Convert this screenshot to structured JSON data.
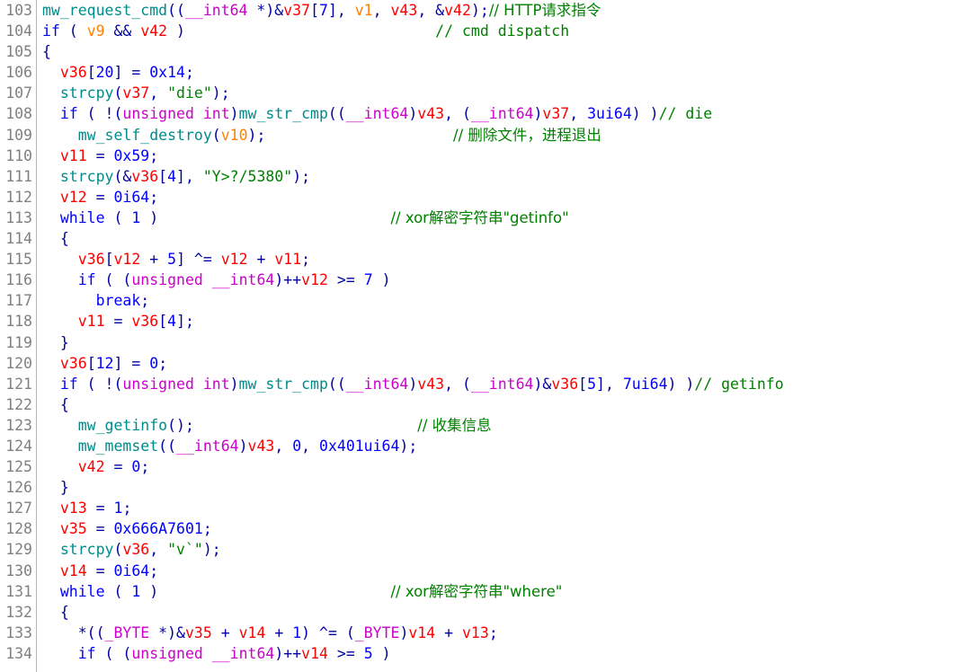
{
  "view": {
    "name": "ida-pseudocode-view",
    "background": "#ffffff",
    "gutter_color": "#808080",
    "separator_color": "#b4b4b4"
  },
  "colors": {
    "keyword": "#0000ff",
    "type": "#cc00cc",
    "function": "#008b8b",
    "local_var": "#ff0000",
    "argument": "#ff8000",
    "number": "#0000ff",
    "string": "#008000",
    "comment": "#008000",
    "punctuation": "#0000a0",
    "default": "#000000"
  },
  "lines": [
    {
      "number": "103",
      "tokens": [
        {
          "t": "mw_request_cmd",
          "c": "func"
        },
        {
          "t": "((",
          "c": "punct"
        },
        {
          "t": "__int64",
          "c": "type"
        },
        {
          "t": " *)&",
          "c": "punct"
        },
        {
          "t": "v37",
          "c": "lvar"
        },
        {
          "t": "[",
          "c": "punct"
        },
        {
          "t": "7",
          "c": "number"
        },
        {
          "t": "], ",
          "c": "punct"
        },
        {
          "t": "v1",
          "c": "arg"
        },
        {
          "t": ", ",
          "c": "punct"
        },
        {
          "t": "v43",
          "c": "lvar"
        },
        {
          "t": ", &",
          "c": "punct"
        },
        {
          "t": "v42",
          "c": "lvar"
        },
        {
          "t": ");",
          "c": "punct"
        },
        {
          "t": "// HTTP请求指令",
          "c": "comment"
        }
      ]
    },
    {
      "number": "104",
      "tokens": [
        {
          "t": "if",
          "c": "keyword"
        },
        {
          "t": " ( ",
          "c": "punct"
        },
        {
          "t": "v9",
          "c": "arg"
        },
        {
          "t": " && ",
          "c": "punct"
        },
        {
          "t": "v42",
          "c": "lvar"
        },
        {
          "t": " )",
          "c": "punct"
        },
        {
          "t": "                            ",
          "c": "default"
        },
        {
          "t": "// cmd dispatch",
          "c": "comment"
        }
      ]
    },
    {
      "number": "105",
      "tokens": [
        {
          "t": "{",
          "c": "punct"
        }
      ]
    },
    {
      "number": "106",
      "tokens": [
        {
          "t": "  ",
          "c": "default"
        },
        {
          "t": "v36",
          "c": "lvar"
        },
        {
          "t": "[",
          "c": "punct"
        },
        {
          "t": "20",
          "c": "number"
        },
        {
          "t": "] = ",
          "c": "punct"
        },
        {
          "t": "0x14",
          "c": "number"
        },
        {
          "t": ";",
          "c": "punct"
        }
      ]
    },
    {
      "number": "107",
      "tokens": [
        {
          "t": "  ",
          "c": "default"
        },
        {
          "t": "strcpy",
          "c": "func"
        },
        {
          "t": "(",
          "c": "punct"
        },
        {
          "t": "v37",
          "c": "lvar"
        },
        {
          "t": ", ",
          "c": "punct"
        },
        {
          "t": "\"die\"",
          "c": "string"
        },
        {
          "t": ");",
          "c": "punct"
        }
      ]
    },
    {
      "number": "108",
      "tokens": [
        {
          "t": "  ",
          "c": "default"
        },
        {
          "t": "if",
          "c": "keyword"
        },
        {
          "t": " ( !(",
          "c": "punct"
        },
        {
          "t": "unsigned int",
          "c": "type"
        },
        {
          "t": ")",
          "c": "punct"
        },
        {
          "t": "mw_str_cmp",
          "c": "func"
        },
        {
          "t": "((",
          "c": "punct"
        },
        {
          "t": "__int64",
          "c": "type"
        },
        {
          "t": ")",
          "c": "punct"
        },
        {
          "t": "v43",
          "c": "lvar"
        },
        {
          "t": ", (",
          "c": "punct"
        },
        {
          "t": "__int64",
          "c": "type"
        },
        {
          "t": ")",
          "c": "punct"
        },
        {
          "t": "v37",
          "c": "lvar"
        },
        {
          "t": ", ",
          "c": "punct"
        },
        {
          "t": "3ui64",
          "c": "number"
        },
        {
          "t": ") )",
          "c": "punct"
        },
        {
          "t": "// die",
          "c": "comment"
        }
      ]
    },
    {
      "number": "109",
      "tokens": [
        {
          "t": "    ",
          "c": "default"
        },
        {
          "t": "mw_self_destroy",
          "c": "func"
        },
        {
          "t": "(",
          "c": "punct"
        },
        {
          "t": "v10",
          "c": "arg"
        },
        {
          "t": ");",
          "c": "punct"
        },
        {
          "t": "                     ",
          "c": "default"
        },
        {
          "t": "// 删除文件，进程退出",
          "c": "comment"
        }
      ]
    },
    {
      "number": "110",
      "tokens": [
        {
          "t": "  ",
          "c": "default"
        },
        {
          "t": "v11",
          "c": "lvar"
        },
        {
          "t": " = ",
          "c": "punct"
        },
        {
          "t": "0x59",
          "c": "number"
        },
        {
          "t": ";",
          "c": "punct"
        }
      ]
    },
    {
      "number": "111",
      "tokens": [
        {
          "t": "  ",
          "c": "default"
        },
        {
          "t": "strcpy",
          "c": "func"
        },
        {
          "t": "(&",
          "c": "punct"
        },
        {
          "t": "v36",
          "c": "lvar"
        },
        {
          "t": "[",
          "c": "punct"
        },
        {
          "t": "4",
          "c": "number"
        },
        {
          "t": "], ",
          "c": "punct"
        },
        {
          "t": "\"Y>?/5380\"",
          "c": "string"
        },
        {
          "t": ");",
          "c": "punct"
        }
      ]
    },
    {
      "number": "112",
      "tokens": [
        {
          "t": "  ",
          "c": "default"
        },
        {
          "t": "v12",
          "c": "lvar"
        },
        {
          "t": " = ",
          "c": "punct"
        },
        {
          "t": "0i64",
          "c": "number"
        },
        {
          "t": ";",
          "c": "punct"
        }
      ]
    },
    {
      "number": "113",
      "tokens": [
        {
          "t": "  ",
          "c": "default"
        },
        {
          "t": "while",
          "c": "keyword"
        },
        {
          "t": " ( ",
          "c": "punct"
        },
        {
          "t": "1",
          "c": "number"
        },
        {
          "t": " )",
          "c": "punct"
        },
        {
          "t": "                          ",
          "c": "default"
        },
        {
          "t": "// xor解密字符串\"getinfo\"",
          "c": "comment"
        }
      ]
    },
    {
      "number": "114",
      "tokens": [
        {
          "t": "  {",
          "c": "punct"
        }
      ]
    },
    {
      "number": "115",
      "tokens": [
        {
          "t": "    ",
          "c": "default"
        },
        {
          "t": "v36",
          "c": "lvar"
        },
        {
          "t": "[",
          "c": "punct"
        },
        {
          "t": "v12",
          "c": "lvar"
        },
        {
          "t": " + ",
          "c": "punct"
        },
        {
          "t": "5",
          "c": "number"
        },
        {
          "t": "] ^= ",
          "c": "punct"
        },
        {
          "t": "v12",
          "c": "lvar"
        },
        {
          "t": " + ",
          "c": "punct"
        },
        {
          "t": "v11",
          "c": "lvar"
        },
        {
          "t": ";",
          "c": "punct"
        }
      ]
    },
    {
      "number": "116",
      "tokens": [
        {
          "t": "    ",
          "c": "default"
        },
        {
          "t": "if",
          "c": "keyword"
        },
        {
          "t": " ( (",
          "c": "punct"
        },
        {
          "t": "unsigned __int64",
          "c": "type"
        },
        {
          "t": ")++",
          "c": "punct"
        },
        {
          "t": "v12",
          "c": "lvar"
        },
        {
          "t": " >= ",
          "c": "punct"
        },
        {
          "t": "7",
          "c": "number"
        },
        {
          "t": " )",
          "c": "punct"
        }
      ]
    },
    {
      "number": "117",
      "tokens": [
        {
          "t": "      ",
          "c": "default"
        },
        {
          "t": "break",
          "c": "keyword"
        },
        {
          "t": ";",
          "c": "punct"
        }
      ]
    },
    {
      "number": "118",
      "tokens": [
        {
          "t": "    ",
          "c": "default"
        },
        {
          "t": "v11",
          "c": "lvar"
        },
        {
          "t": " = ",
          "c": "punct"
        },
        {
          "t": "v36",
          "c": "lvar"
        },
        {
          "t": "[",
          "c": "punct"
        },
        {
          "t": "4",
          "c": "number"
        },
        {
          "t": "];",
          "c": "punct"
        }
      ]
    },
    {
      "number": "119",
      "tokens": [
        {
          "t": "  }",
          "c": "punct"
        }
      ]
    },
    {
      "number": "120",
      "tokens": [
        {
          "t": "  ",
          "c": "default"
        },
        {
          "t": "v36",
          "c": "lvar"
        },
        {
          "t": "[",
          "c": "punct"
        },
        {
          "t": "12",
          "c": "number"
        },
        {
          "t": "] = ",
          "c": "punct"
        },
        {
          "t": "0",
          "c": "number"
        },
        {
          "t": ";",
          "c": "punct"
        }
      ]
    },
    {
      "number": "121",
      "tokens": [
        {
          "t": "  ",
          "c": "default"
        },
        {
          "t": "if",
          "c": "keyword"
        },
        {
          "t": " ( !(",
          "c": "punct"
        },
        {
          "t": "unsigned int",
          "c": "type"
        },
        {
          "t": ")",
          "c": "punct"
        },
        {
          "t": "mw_str_cmp",
          "c": "func"
        },
        {
          "t": "((",
          "c": "punct"
        },
        {
          "t": "__int64",
          "c": "type"
        },
        {
          "t": ")",
          "c": "punct"
        },
        {
          "t": "v43",
          "c": "lvar"
        },
        {
          "t": ", (",
          "c": "punct"
        },
        {
          "t": "__int64",
          "c": "type"
        },
        {
          "t": ")&",
          "c": "punct"
        },
        {
          "t": "v36",
          "c": "lvar"
        },
        {
          "t": "[",
          "c": "punct"
        },
        {
          "t": "5",
          "c": "number"
        },
        {
          "t": "], ",
          "c": "punct"
        },
        {
          "t": "7ui64",
          "c": "number"
        },
        {
          "t": ") )",
          "c": "punct"
        },
        {
          "t": "// getinfo",
          "c": "comment"
        }
      ]
    },
    {
      "number": "122",
      "tokens": [
        {
          "t": "  {",
          "c": "punct"
        }
      ]
    },
    {
      "number": "123",
      "tokens": [
        {
          "t": "    ",
          "c": "default"
        },
        {
          "t": "mw_getinfo",
          "c": "func"
        },
        {
          "t": "();",
          "c": "punct"
        },
        {
          "t": "                         ",
          "c": "default"
        },
        {
          "t": "// 收集信息",
          "c": "comment"
        }
      ]
    },
    {
      "number": "124",
      "tokens": [
        {
          "t": "    ",
          "c": "default"
        },
        {
          "t": "mw_memset",
          "c": "func"
        },
        {
          "t": "((",
          "c": "punct"
        },
        {
          "t": "__int64",
          "c": "type"
        },
        {
          "t": ")",
          "c": "punct"
        },
        {
          "t": "v43",
          "c": "lvar"
        },
        {
          "t": ", ",
          "c": "punct"
        },
        {
          "t": "0",
          "c": "number"
        },
        {
          "t": ", ",
          "c": "punct"
        },
        {
          "t": "0x401ui64",
          "c": "number"
        },
        {
          "t": ");",
          "c": "punct"
        }
      ]
    },
    {
      "number": "125",
      "tokens": [
        {
          "t": "    ",
          "c": "default"
        },
        {
          "t": "v42",
          "c": "lvar"
        },
        {
          "t": " = ",
          "c": "punct"
        },
        {
          "t": "0",
          "c": "number"
        },
        {
          "t": ";",
          "c": "punct"
        }
      ]
    },
    {
      "number": "126",
      "tokens": [
        {
          "t": "  }",
          "c": "punct"
        }
      ]
    },
    {
      "number": "127",
      "tokens": [
        {
          "t": "  ",
          "c": "default"
        },
        {
          "t": "v13",
          "c": "lvar"
        },
        {
          "t": " = ",
          "c": "punct"
        },
        {
          "t": "1",
          "c": "number"
        },
        {
          "t": ";",
          "c": "punct"
        }
      ]
    },
    {
      "number": "128",
      "tokens": [
        {
          "t": "  ",
          "c": "default"
        },
        {
          "t": "v35",
          "c": "lvar"
        },
        {
          "t": " = ",
          "c": "punct"
        },
        {
          "t": "0x666A7601",
          "c": "number"
        },
        {
          "t": ";",
          "c": "punct"
        }
      ]
    },
    {
      "number": "129",
      "tokens": [
        {
          "t": "  ",
          "c": "default"
        },
        {
          "t": "strcpy",
          "c": "func"
        },
        {
          "t": "(",
          "c": "punct"
        },
        {
          "t": "v36",
          "c": "lvar"
        },
        {
          "t": ", ",
          "c": "punct"
        },
        {
          "t": "\"v`\"",
          "c": "string"
        },
        {
          "t": ");",
          "c": "punct"
        }
      ]
    },
    {
      "number": "130",
      "tokens": [
        {
          "t": "  ",
          "c": "default"
        },
        {
          "t": "v14",
          "c": "lvar"
        },
        {
          "t": " = ",
          "c": "punct"
        },
        {
          "t": "0i64",
          "c": "number"
        },
        {
          "t": ";",
          "c": "punct"
        }
      ]
    },
    {
      "number": "131",
      "tokens": [
        {
          "t": "  ",
          "c": "default"
        },
        {
          "t": "while",
          "c": "keyword"
        },
        {
          "t": " ( ",
          "c": "punct"
        },
        {
          "t": "1",
          "c": "number"
        },
        {
          "t": " )",
          "c": "punct"
        },
        {
          "t": "                          ",
          "c": "default"
        },
        {
          "t": "// xor解密字符串\"where\"",
          "c": "comment"
        }
      ]
    },
    {
      "number": "132",
      "tokens": [
        {
          "t": "  {",
          "c": "punct"
        }
      ]
    },
    {
      "number": "133",
      "tokens": [
        {
          "t": "    *((",
          "c": "punct"
        },
        {
          "t": "_BYTE",
          "c": "type"
        },
        {
          "t": " *)&",
          "c": "punct"
        },
        {
          "t": "v35",
          "c": "lvar"
        },
        {
          "t": " + ",
          "c": "punct"
        },
        {
          "t": "v14",
          "c": "lvar"
        },
        {
          "t": " + ",
          "c": "punct"
        },
        {
          "t": "1",
          "c": "number"
        },
        {
          "t": ") ^= (",
          "c": "punct"
        },
        {
          "t": "_BYTE",
          "c": "type"
        },
        {
          "t": ")",
          "c": "punct"
        },
        {
          "t": "v14",
          "c": "lvar"
        },
        {
          "t": " + ",
          "c": "punct"
        },
        {
          "t": "v13",
          "c": "lvar"
        },
        {
          "t": ";",
          "c": "punct"
        }
      ]
    },
    {
      "number": "134",
      "tokens": [
        {
          "t": "    ",
          "c": "default"
        },
        {
          "t": "if",
          "c": "keyword"
        },
        {
          "t": " ( (",
          "c": "punct"
        },
        {
          "t": "unsigned __int64",
          "c": "type"
        },
        {
          "t": ")++",
          "c": "punct"
        },
        {
          "t": "v14",
          "c": "lvar"
        },
        {
          "t": " >= ",
          "c": "punct"
        },
        {
          "t": "5",
          "c": "number"
        },
        {
          "t": " )",
          "c": "punct"
        }
      ]
    }
  ]
}
